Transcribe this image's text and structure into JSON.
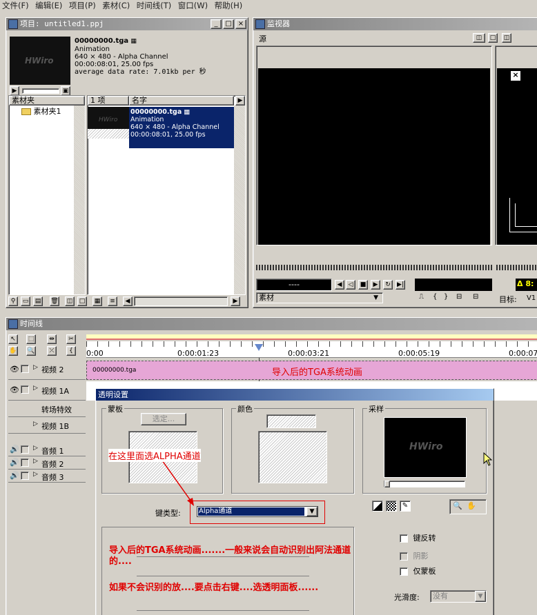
{
  "menu": [
    "文件(F)",
    "编辑(E)",
    "项目(P)",
    "素材(C)",
    "时间线(T)",
    "窗口(W)",
    "帮助(H)"
  ],
  "project": {
    "title": "项目: untitled1.ppj",
    "preview_logo": "HWiro",
    "file_name": "00000000.tga",
    "file_type": "Animation",
    "file_dims": "640 × 480 - Alpha Channel",
    "file_dur": "00:00:08:01, 25.00 fps",
    "data_rate": "average data rate: 7.01kb per 秒",
    "bin_header": "素材夹",
    "bin_item": "素材夹1",
    "count_header": "1 项",
    "name_header": "名字"
  },
  "monitor": {
    "title": "监视器",
    "source_label": "源",
    "timecode": "----",
    "clip_select": "素材",
    "target_label": "目标:",
    "target_value": "V1",
    "right_tc": "Δ 8:"
  },
  "timeline": {
    "title": "时间线",
    "ruler": [
      "0:00",
      "0:00:01:23",
      "0:00:03:21",
      "0:00:05:19",
      "0:00:07:"
    ],
    "tracks": [
      "视频 2",
      "视频 1A",
      "转场特效",
      "视频 1B",
      "音频 1",
      "音频 2",
      "音频 3"
    ],
    "clip_name": "00000000.tga",
    "clip_note": "导入后的TGA系统动画"
  },
  "dialog": {
    "title": "透明设置",
    "matte_group": "蒙板",
    "select_btn": "选定...",
    "color_group": "颜色",
    "sample_group": "采样",
    "keytype_label": "键类型:",
    "keytype_value": "Alpha通道",
    "reverse_key": "键反转",
    "shadow": "阴影",
    "mask_only": "仅蒙板",
    "smooth_label": "光滑度:",
    "smooth_value": "没有",
    "note_alpha": "在这里面选ALPHA通道",
    "note_1": "导入后的TGA系统动画.......一般来说会自动识别出阿法通道的....",
    "note_2": "如果不会识别的放....要点击右键....选透明面板......"
  },
  "colors": {
    "selection": "#0a246a",
    "clip": "#e6a6d6",
    "note_red": "#e00000"
  }
}
